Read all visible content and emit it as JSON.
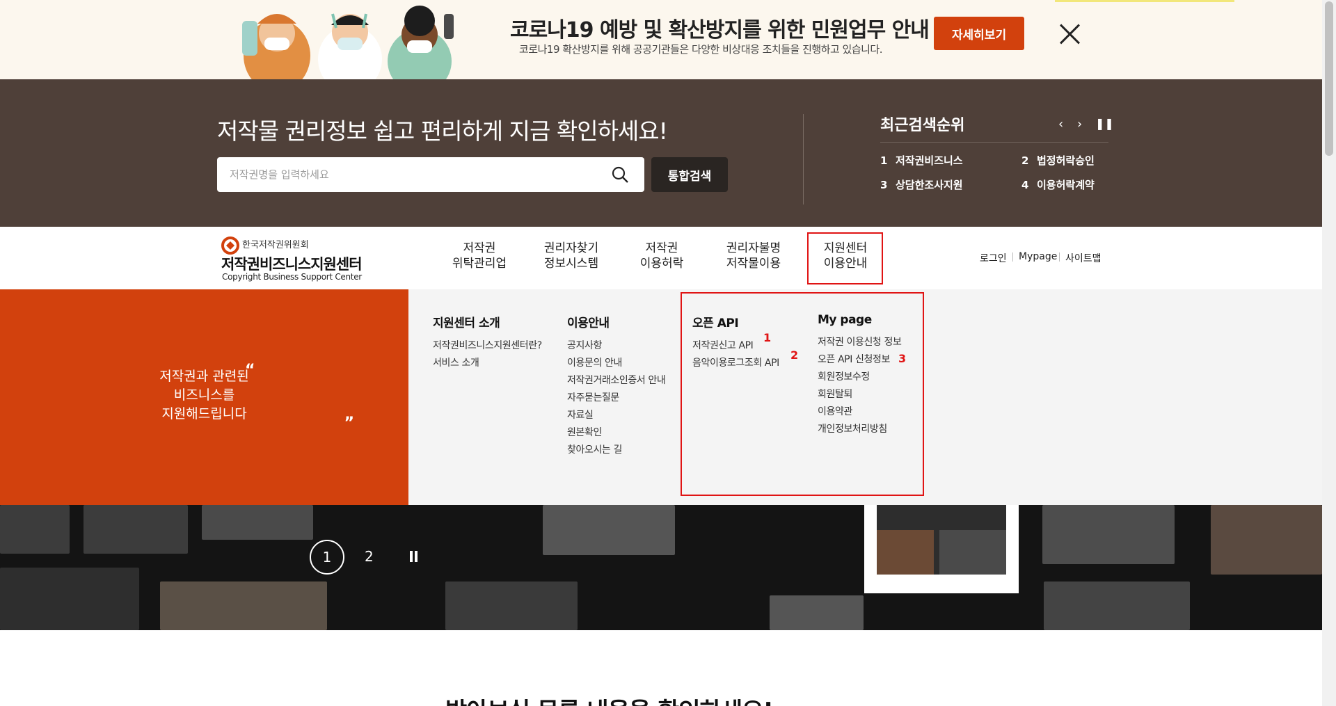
{
  "covid_banner": {
    "title": "코로나19 예방 및 확산방지를 위한 민원업무 안내",
    "subtitle": "코로나19 확산방지를 위해 공공기관들은 다양한 비상대응 조치들을 진행하고 있습니다.",
    "detail_button": "자세히보기"
  },
  "search": {
    "heading": "저작물 권리정보 쉽고 편리하게 지금 확인하세요!",
    "placeholder": "저작권명을 입력하세요",
    "button": "통합검색"
  },
  "ranking": {
    "title": "최근검색순위",
    "items": [
      {
        "num": "1",
        "label": "저작권비즈니스"
      },
      {
        "num": "2",
        "label": "법정허락승인"
      },
      {
        "num": "3",
        "label": "상담한조사지원"
      },
      {
        "num": "4",
        "label": "이용허락계약"
      }
    ]
  },
  "logo": {
    "org": "한국저작권위원회",
    "name": "저작권비즈니스지원센터",
    "eng": "Copyright Business Support Center"
  },
  "gnb": [
    {
      "line1": "저작권",
      "line2": "위탁관리업"
    },
    {
      "line1": "권리자찾기",
      "line2": "정보시스템"
    },
    {
      "line1": "저작권",
      "line2": "이용허락"
    },
    {
      "line1": "권리자불명",
      "line2": "저작물이용"
    },
    {
      "line1": "지원센터",
      "line2": "이용안내"
    }
  ],
  "util": {
    "login": "로그인",
    "mypage": "Mypage",
    "sitemap": "사이트맵"
  },
  "mega": {
    "quote_open": "“",
    "quote_close": "„",
    "quote": [
      "저작권과 관련된",
      "비즈니스를",
      "지원해드립니다"
    ],
    "columns": [
      {
        "title": "지원센터 소개",
        "items": [
          "저작권비즈니스지원센터란?",
          "서비스 소개"
        ]
      },
      {
        "title": "이용안내",
        "items": [
          "공지사항",
          "이용문의 안내",
          "저작권거래소인증서 안내",
          "자주묻는질문",
          "자료실",
          "원본확인",
          "찾아오시는 길"
        ]
      },
      {
        "title": "오픈 API",
        "items": [
          "저작권신고 API",
          "음악이용로그조회 API"
        ]
      },
      {
        "title": "My page",
        "items": [
          "저작권 이용신청 정보",
          "오픈 API 신청정보",
          "회원정보수정",
          "회원탈퇴",
          "이용약관",
          "개인정보처리방침"
        ]
      }
    ],
    "markers": [
      "1",
      "2",
      "3"
    ]
  },
  "hero": {
    "pages": [
      "1",
      "2"
    ]
  },
  "bottom_heading": "받아보실 목록 내용을 확인하세요!",
  "colors": {
    "accent": "#d2410d",
    "brown": "#4f4039",
    "highlight": "#e01414"
  }
}
